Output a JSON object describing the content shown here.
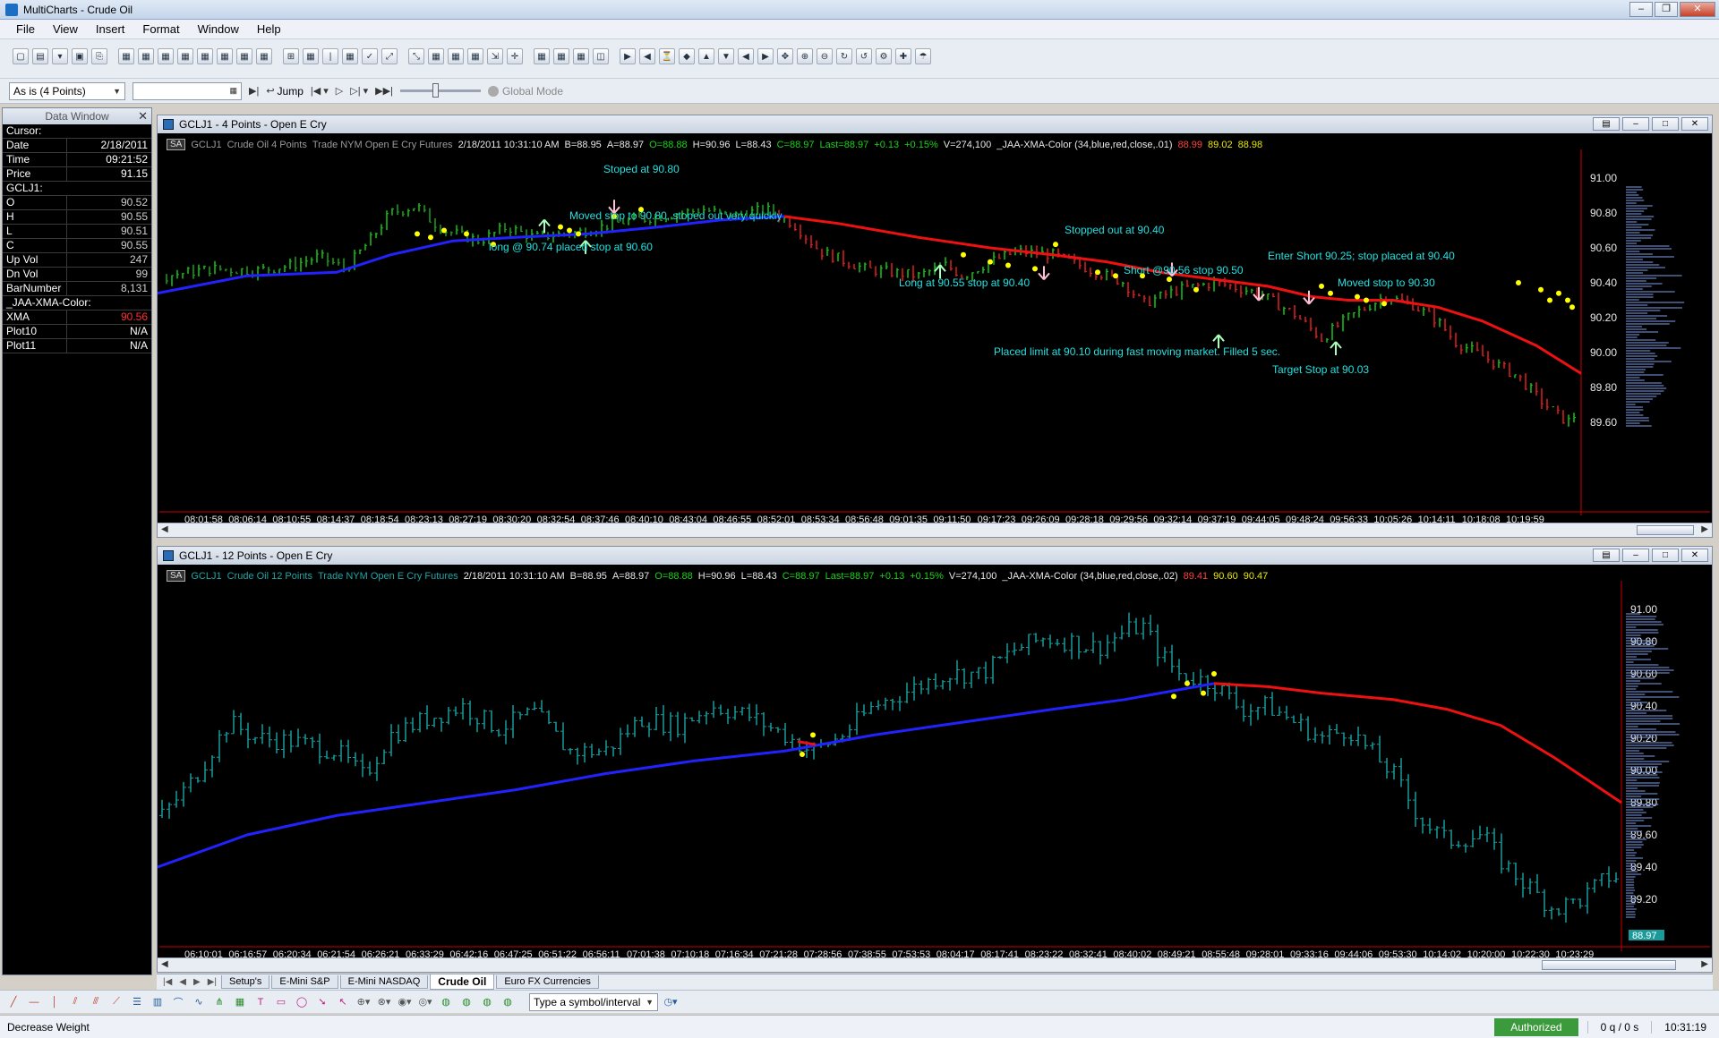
{
  "app": {
    "title": "MultiCharts - Crude Oil"
  },
  "menu": [
    "File",
    "View",
    "Insert",
    "Format",
    "Window",
    "Help"
  ],
  "toolbar2": {
    "resolution": "As is (4 Points)",
    "jump_label": "Jump",
    "global_mode": "Global Mode"
  },
  "data_window": {
    "title": "Data Window",
    "rows": [
      {
        "k": "Cursor:",
        "v": "",
        "section": true
      },
      {
        "k": "Date",
        "v": "2/18/2011"
      },
      {
        "k": "Time",
        "v": "09:21:52"
      },
      {
        "k": "Price",
        "v": "91.15"
      },
      {
        "k": "GCLJ1:",
        "v": "",
        "section": true
      },
      {
        "k": "O",
        "v": "90.52",
        "dim": true
      },
      {
        "k": "H",
        "v": "90.55",
        "dim": true
      },
      {
        "k": "L",
        "v": "90.51",
        "dim": true
      },
      {
        "k": "C",
        "v": "90.55",
        "dim": true
      },
      {
        "k": "Up Vol",
        "v": "247",
        "dim": true
      },
      {
        "k": "Dn Vol",
        "v": "99",
        "dim": true
      },
      {
        "k": "BarNumber",
        "v": "8,131",
        "dim": true
      },
      {
        "k": "_JAA-XMA-Color:",
        "v": "",
        "section": true
      },
      {
        "k": "XMA",
        "v": "90.56",
        "red": true
      },
      {
        "k": "Plot10",
        "v": "N/A"
      },
      {
        "k": "Plot11",
        "v": "N/A"
      }
    ]
  },
  "chart1": {
    "title": "GCLJ1 - 4 Points - Open E Cry",
    "info": {
      "sa": "SA",
      "symbol": "GCLJ1",
      "desc": "Crude Oil  4 Points",
      "extra": "Trade  NYM  Open E Cry  Futures",
      "datetime": "2/18/2011  10:31:10 AM",
      "bid": "B=88.95",
      "ask": "A=88.97",
      "open": "O=88.88",
      "high": "H=90.96",
      "low": "L=88.43",
      "close": "C=88.97",
      "last": "Last=88.97",
      "chg": "+0.13",
      "chgpct": "+0.15%",
      "vol": "V=274,100",
      "study": "_JAA-XMA-Color  (34,blue,red,close,.01)",
      "s1": "88.99",
      "s2": "89.02",
      "s3": "88.98"
    },
    "price_labels": [
      "91.00",
      "90.80",
      "90.60",
      "90.40",
      "90.20",
      "90.00",
      "89.80",
      "89.60"
    ],
    "time_labels": [
      "08:01:58",
      "08:06:14",
      "08:10:55",
      "08:14:37",
      "08:18:54",
      "08:23:13",
      "08:27:19",
      "08:30:20",
      "08:32:54",
      "08:37:46",
      "08:40:10",
      "08:43:04",
      "08:46:55",
      "08:52:01",
      "08:53:34",
      "08:56:48",
      "09:01:35",
      "09:11:50",
      "09:17:23",
      "09:26:09",
      "09:28:18",
      "09:29:56",
      "09:32:14",
      "09:37:19",
      "09:44:05",
      "09:48:24",
      "09:56:33",
      "10:05:26",
      "10:14:11",
      "10:18:08",
      "10:19:59"
    ],
    "annotations": [
      "Stoped at 90.80",
      "Moved stop to 90.80, stoped out very quickly",
      "long @ 90.74 placed stop at 90.60",
      "Stopped out at 90.40",
      "Long at 90.55 stop at 90.40",
      "Short @90.56 stop 90.50",
      "Enter Short 90.25; stop placed at 90.40",
      "Moved stop to 90.30",
      "Placed limit at 90.10 during fast moving market. Filled 5 sec.",
      "Target Stop at 90.03"
    ]
  },
  "chart2": {
    "title": "GCLJ1 - 12 Points - Open E Cry",
    "info": {
      "sa": "SA",
      "symbol": "GCLJ1",
      "desc": "Crude Oil  12 Points",
      "extra": "Trade  NYM  Open E Cry  Futures",
      "datetime": "2/18/2011  10:31:10 AM",
      "bid": "B=88.95",
      "ask": "A=88.97",
      "open": "O=88.88",
      "high": "H=90.96",
      "low": "L=88.43",
      "close": "C=88.97",
      "last": "Last=88.97",
      "chg": "+0.13",
      "chgpct": "+0.15%",
      "vol": "V=274,100",
      "study": "_JAA-XMA-Color  (34,blue,red,close,.02)",
      "s1": "89.41",
      "s2": "90.60",
      "s3": "90.47"
    },
    "price_labels": [
      "91.00",
      "90.80",
      "90.60",
      "90.40",
      "90.20",
      "90.00",
      "89.80",
      "89.60",
      "89.40",
      "89.20"
    ],
    "last_price_tag": "88.97",
    "time_labels": [
      "06:10:01",
      "06:16:57",
      "06:20:34",
      "06:21:54",
      "06:26:21",
      "06:33:29",
      "06:42:16",
      "06:47:25",
      "06:51:22",
      "06:56:11",
      "07:01:38",
      "07:10:18",
      "07:16:34",
      "07:21:28",
      "07:28:56",
      "07:38:55",
      "07:53:53",
      "08:04:17",
      "08:17:41",
      "08:23:22",
      "08:32:41",
      "08:40:02",
      "08:49:21",
      "08:55:48",
      "09:28:01",
      "09:33:16",
      "09:44:06",
      "09:53:30",
      "10:14:02",
      "10:20:00",
      "10:22:30",
      "10:23:29"
    ]
  },
  "tabs": [
    "Setup's",
    "E-Mini S&P",
    "E-Mini NASDAQ",
    "Crude Oil",
    "Euro FX Currencies"
  ],
  "active_tab": "Crude Oil",
  "drawbar": {
    "symbol_combo": "Type a symbol/interval"
  },
  "status": {
    "text": "Decrease Weight",
    "auth": "Authorized",
    "queue": "0 q / 0 s",
    "clock": "10:31:19"
  },
  "colors": {
    "up_bar": "#18c418",
    "down_bar": "#e02020",
    "ma_up": "#2222ff",
    "ma_down": "#ee1111",
    "teal_bar": "#1a9a9a",
    "annotation": "#22e0e0",
    "marker": "#ffff00"
  }
}
